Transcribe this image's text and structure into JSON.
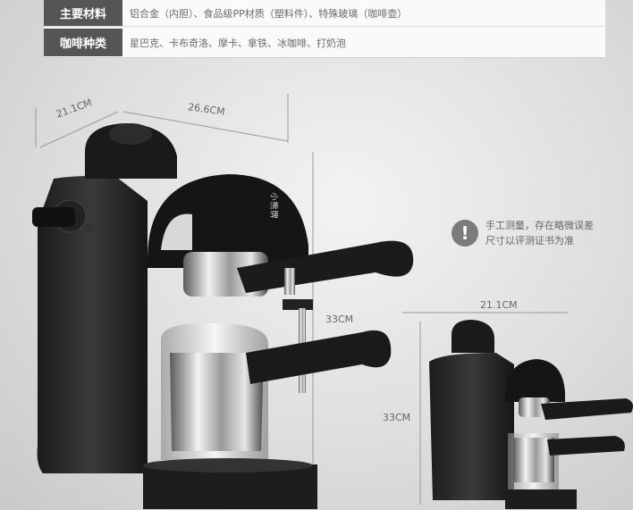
{
  "spec_table": {
    "rows": [
      {
        "label": "主要材料",
        "value": "铝合金（内胆）、食品级PP材质（塑料件）、特殊玻璃（咖啡壶）"
      },
      {
        "label": "咖啡种类",
        "value": "星巴克、卡布奇洛、摩卡、拿铁、冰咖啡、打奶泡"
      }
    ]
  },
  "dimensions": {
    "depth": "21.1CM",
    "width": "26.6CM",
    "height": "33CM",
    "small_depth": "21.1CM",
    "small_height": "33CM"
  },
  "note": {
    "icon": "exclamation-icon",
    "line1": "手工测量，存在略微误差",
    "line2": "尺寸以评测证书为准"
  },
  "brand_label": "小熊牌"
}
